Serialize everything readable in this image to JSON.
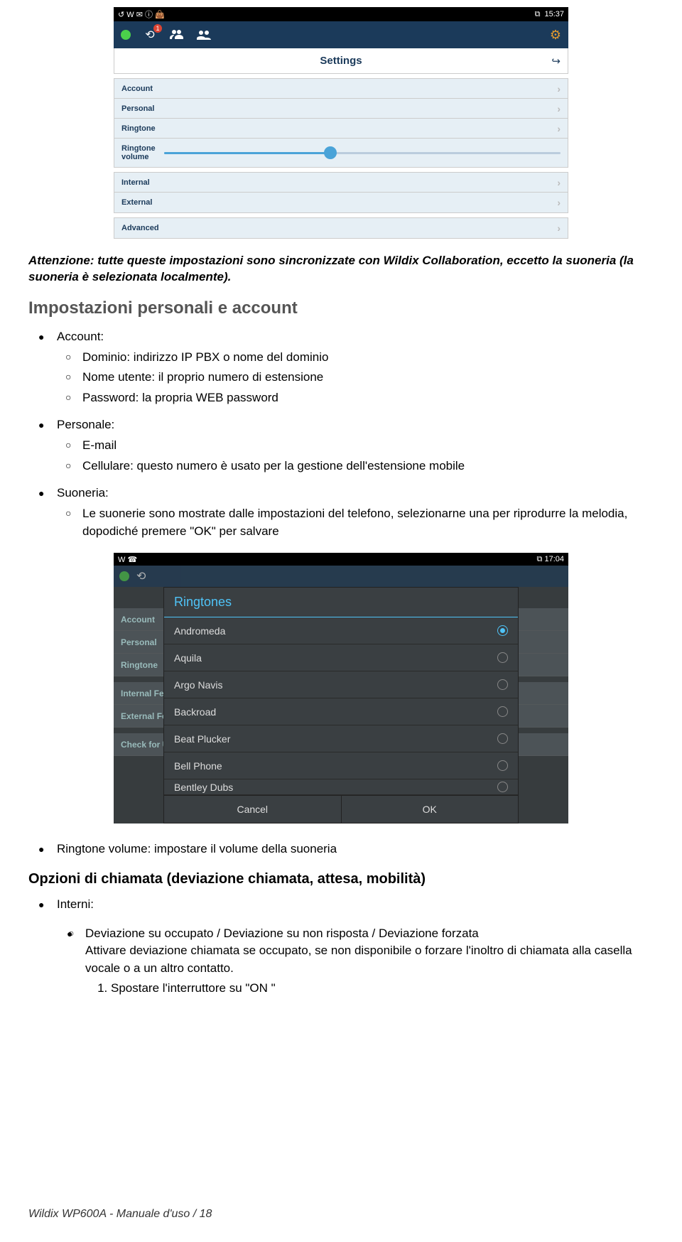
{
  "screenshot1": {
    "statusbar": {
      "left_icons": "↺  W  ✉  ⓘ  👜",
      "right_icon": "⧉",
      "time": "15:37"
    },
    "navbar": {
      "badge": "1"
    },
    "title": "Settings",
    "group1": {
      "account": "Account",
      "personal": "Personal",
      "ringtone": "Ringtone",
      "ringtone_volume": "Ringtone volume"
    },
    "group2": {
      "internal": "Internal",
      "external": "External"
    },
    "group3": {
      "advanced": "Advanced"
    }
  },
  "attention": "Attenzione: tutte queste impostazioni sono sincronizzate con  Wildix Collaboration, eccetto la suoneria (la suoneria è selezionata localmente).",
  "headings": {
    "impostazioni": "Impostazioni personali e account",
    "opzioni": "Opzioni di chiamata (deviazione chiamata, attesa, mobilità)"
  },
  "bullets": {
    "account_title": "Account:",
    "account_dominio": "Dominio: indirizzo IP PBX o nome del dominio",
    "account_nome": "Nome utente: il proprio numero di estensione",
    "account_pwd": "Password: la propria WEB password",
    "personale_title": "Personale:",
    "personale_email": "E-mail",
    "personale_cell": "Cellulare: questo numero è usato per la gestione dell'estensione mobile",
    "suoneria_title": "Suoneria:",
    "suoneria_text": "Le suonerie sono mostrate dalle impostazioni del telefono, selezionarne una per riprodurre la melodia, dopodiché premere \"OK\" per salvare",
    "ringtone_vol": "Ringtone volume: impostare il volume della suoneria",
    "interni": "Interni:",
    "dev_title": "Deviazione su occupato / Deviazione su non risposta / Deviazione forzata",
    "dev_text": "Attivare deviazione chiamata se occupato, se non disponibile  o forzare l'inoltro di chiamata alla casella vocale o a un altro contatto.",
    "dev_step1": "Spostare l'interruttore su  \"ON \""
  },
  "screenshot2": {
    "time": "17:04",
    "left": "W  ☎",
    "dlg_title": "Ringtones",
    "rows": {
      "r1": "Andromeda",
      "r2": "Aquila",
      "r3": "Argo Navis",
      "r4": "Backroad",
      "r5": "Beat Plucker",
      "r6": "Bell Phone",
      "r7": "Bentley Dubs"
    },
    "cancel": "Cancel",
    "ok": "OK",
    "bg": {
      "account": "Account",
      "personal": "Personal",
      "ringtone": "Ringtone",
      "internal": "Internal Feature",
      "external": "External Feature",
      "check": "Check for Updat"
    }
  },
  "footer": "Wildix WP600A - Manuale d'uso / 18"
}
